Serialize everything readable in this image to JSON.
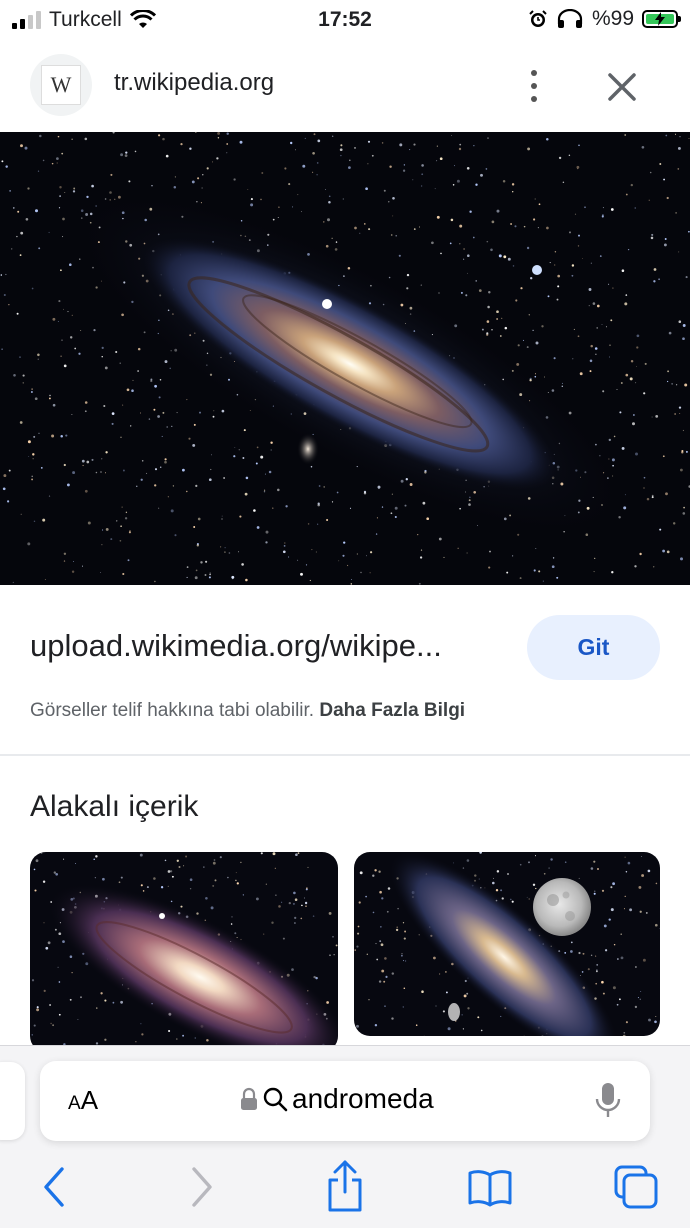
{
  "status_bar": {
    "carrier": "Turkcell",
    "time": "17:52",
    "battery": "%99"
  },
  "header": {
    "favicon_letter": "W",
    "domain": "tr.wikipedia.org"
  },
  "result": {
    "source_url": "upload.wikimedia.org/wikipe...",
    "go_button": "Git",
    "copyright_notice": "Görseller telif hakkına tabi olabilir.",
    "learn_more": "Daha Fazla Bilgi"
  },
  "related": {
    "title": "Alakalı içerik"
  },
  "browser": {
    "text_size_small": "A",
    "text_size_large": "A",
    "query": "andromeda"
  },
  "icons": [
    "signal-icon",
    "wifi-icon",
    "alarm-icon",
    "headphones-icon",
    "battery-icon",
    "more-vert-icon",
    "close-icon",
    "lock-icon",
    "search-icon",
    "mic-icon",
    "back-icon",
    "forward-icon",
    "share-icon",
    "bookmarks-icon",
    "tabs-icon"
  ],
  "colors": {
    "accent_blue": "#1a73e8",
    "go_button_bg": "#e8f0fe",
    "battery_green": "#34c759"
  }
}
